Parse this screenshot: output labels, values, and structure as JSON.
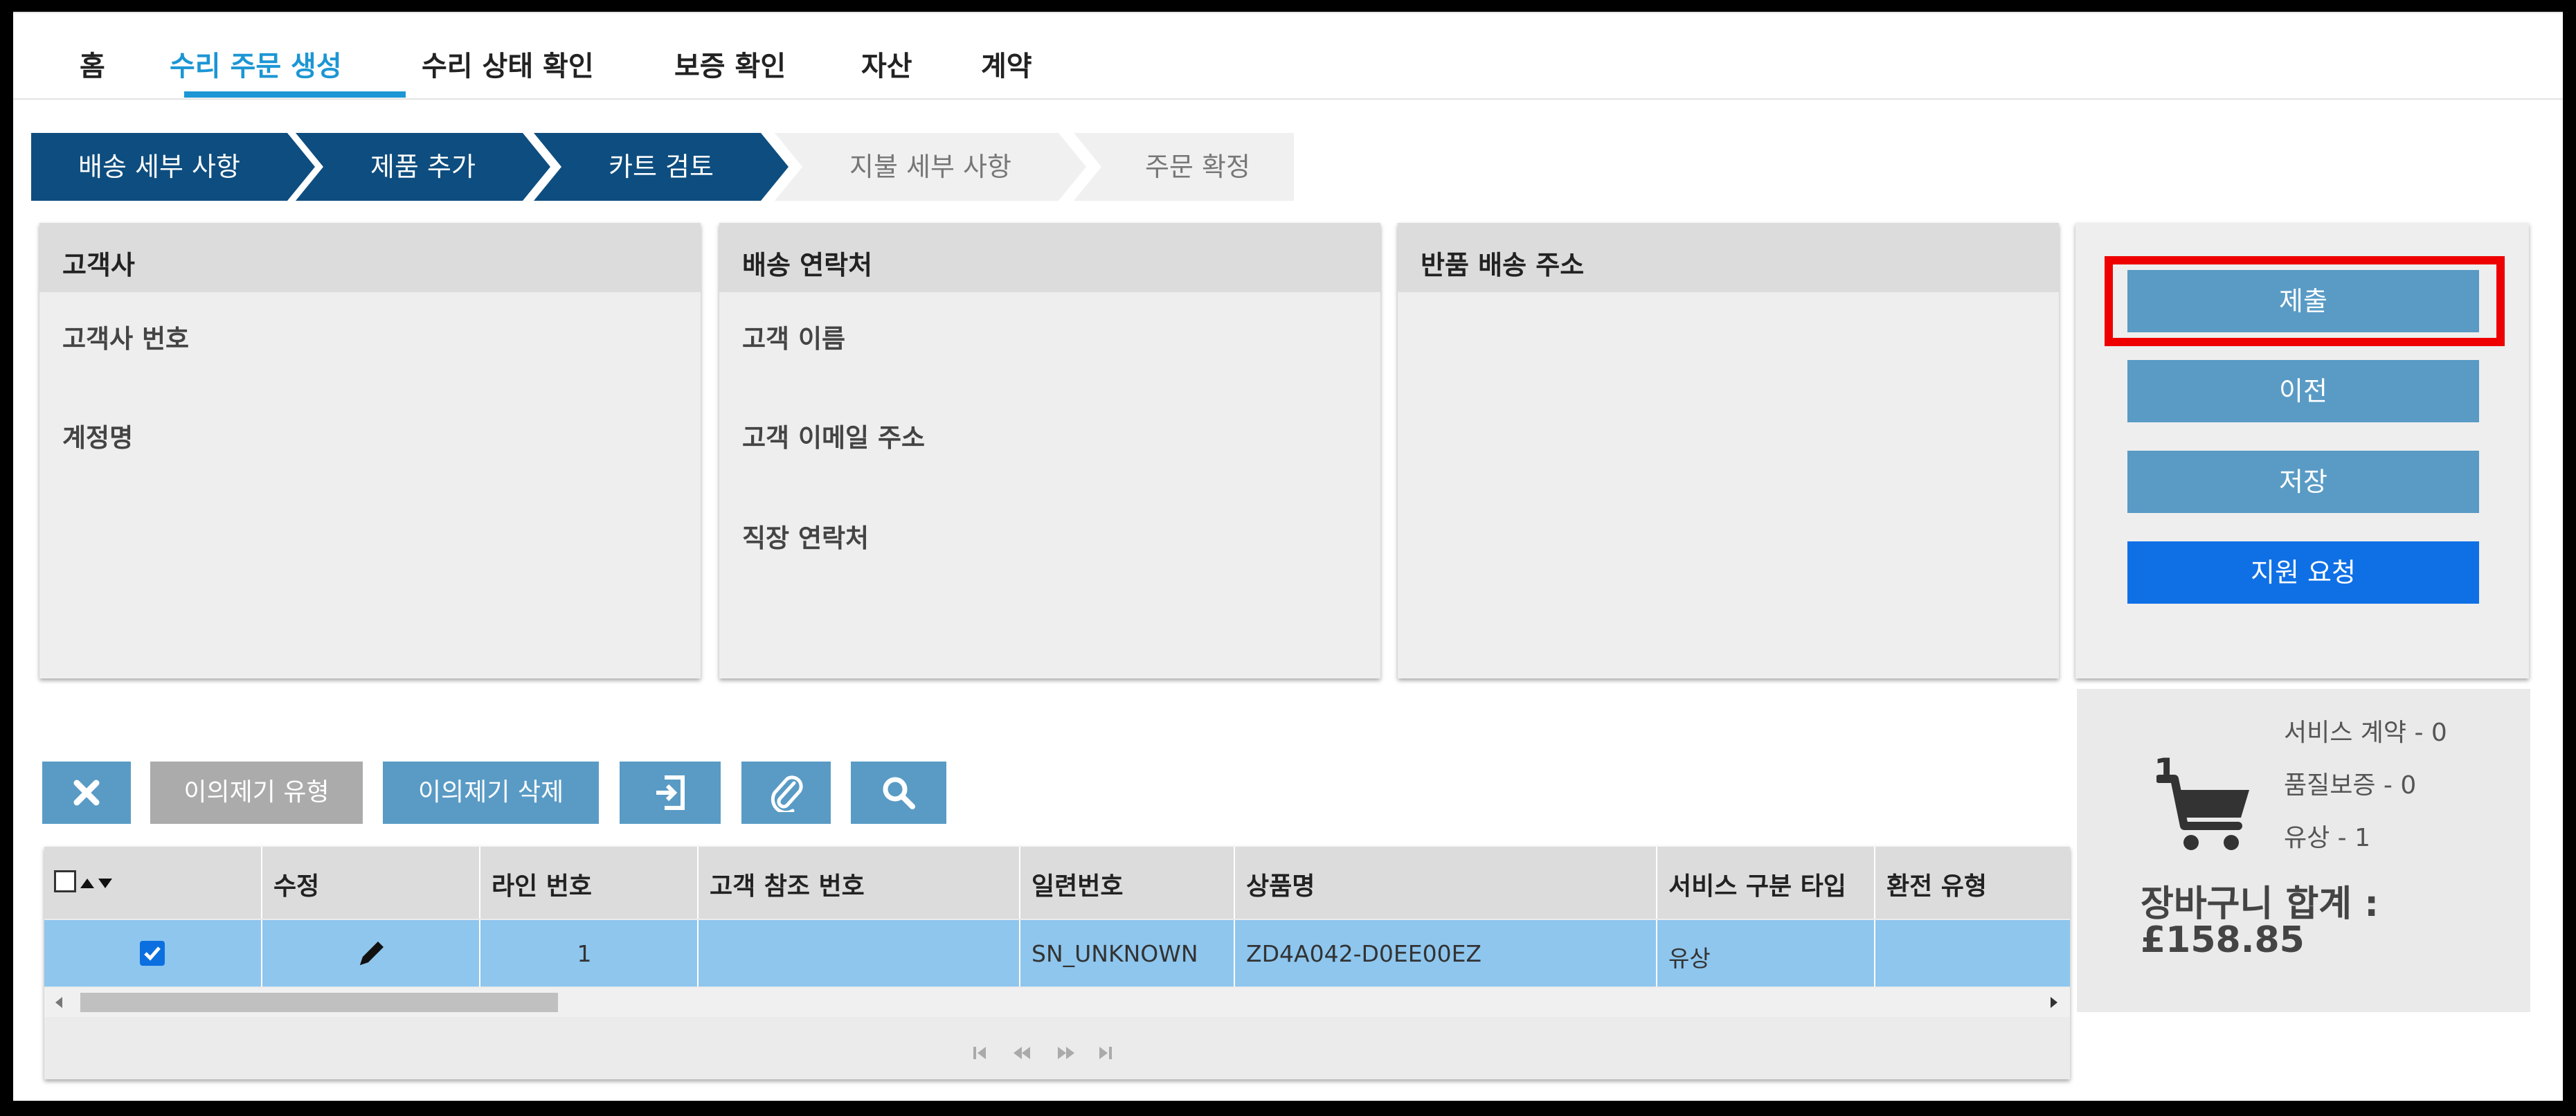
{
  "nav": {
    "items": [
      "홈",
      "수리 주문 생성",
      "수리 상태 확인",
      "보증 확인",
      "자산",
      "계약"
    ],
    "active_index": 1
  },
  "steps": {
    "items": [
      "배송 세부 사항",
      "제품 추가",
      "카트 검토",
      "지불 세부 사항",
      "주문 확정"
    ],
    "completed_count": 3
  },
  "panels": {
    "customer": {
      "title": "고객사",
      "fields": [
        "고객사 번호",
        "계정명"
      ]
    },
    "shipping_contact": {
      "title": "배송 연락처",
      "fields": [
        "고객 이름",
        "고객 이메일 주소",
        "직장 연락처"
      ]
    },
    "return_address": {
      "title": "반품 배송 주소"
    }
  },
  "actions": {
    "submit": "제출",
    "previous": "이전",
    "save": "저장",
    "support": "지원 요청"
  },
  "cart": {
    "count": "1",
    "lines": [
      "서비스 계약 - 0",
      "품질보증 - 0",
      "유상 - 1"
    ],
    "total_label": "장바구니 합계 :",
    "total_value": "£158.85"
  },
  "toolbar": {
    "complaint_type": "이의제기 유형",
    "complaint_delete": "이의제기 삭제",
    "icons": [
      "close-icon",
      "export-icon",
      "attachment-icon",
      "search-icon"
    ]
  },
  "grid": {
    "headers": [
      "",
      "수정",
      "라인 번호",
      "고객 참조 번호",
      "일련번호",
      "상품명",
      "서비스 구분 타입",
      "환전 유형"
    ],
    "rows": [
      {
        "checked": true,
        "line_no": "1",
        "customer_ref": "",
        "serial": "SN_UNKNOWN",
        "product": "ZD4A042-D0EE00EZ",
        "service_type": "유상",
        "exchange_type": ""
      }
    ]
  },
  "colors": {
    "accent": "#1c96d4",
    "step_done": "#0e4d7f",
    "step_todo": "#f0f0f0",
    "button": "#599bc5",
    "button_primary": "#0f70e6",
    "highlight": "#ee0000",
    "row_selected": "#8ec6ee"
  }
}
